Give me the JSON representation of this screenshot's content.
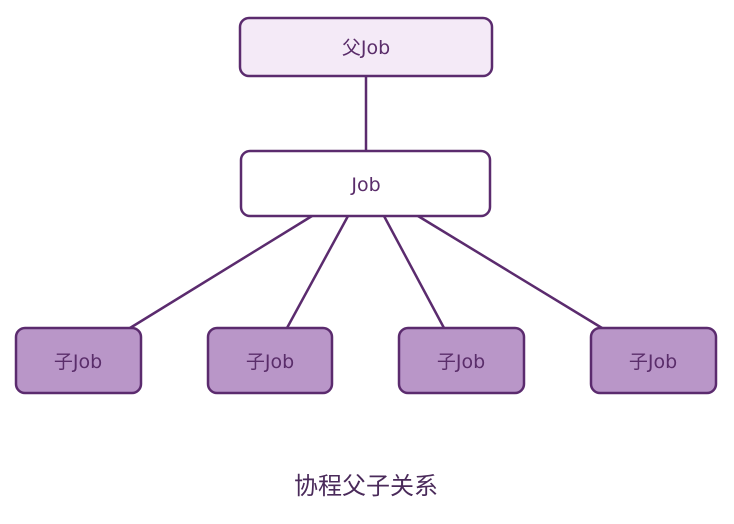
{
  "diagram": {
    "parent_label": "父Job",
    "job_label": "Job",
    "children": [
      {
        "label": "子Job"
      },
      {
        "label": "子Job"
      },
      {
        "label": "子Job"
      },
      {
        "label": "子Job"
      }
    ],
    "caption": "协程父子关系"
  },
  "colors": {
    "parent_fill": "#f4eaf7",
    "job_fill": "#ffffff",
    "child_fill": "#b996c8",
    "stroke": "#5b2b6e",
    "text": "#5a2d6a"
  }
}
